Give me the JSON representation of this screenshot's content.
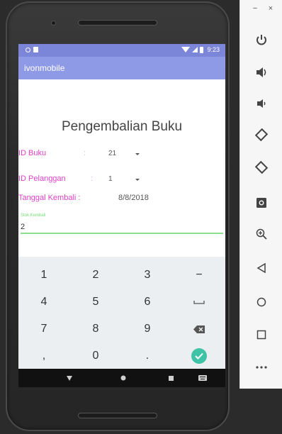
{
  "status_bar": {
    "time": "9:23"
  },
  "app": {
    "title": "ivonmobile"
  },
  "form": {
    "title": "Pengembalian Buku",
    "id_buku": {
      "label": "ID Buku",
      "colon": ":",
      "value": "21"
    },
    "id_pelanggan": {
      "label": "ID Pelanggan",
      "colon": ":",
      "value": "1"
    },
    "tanggal_kembali": {
      "label": "Tanggal Kembali :",
      "value": "8/8/2018"
    },
    "stok_kembali": {
      "hint": "Stok Kembali",
      "value": "2"
    }
  },
  "keyboard": {
    "keys": [
      {
        "label": "1",
        "name": "key-1"
      },
      {
        "label": "2",
        "name": "key-2"
      },
      {
        "label": "3",
        "name": "key-3"
      },
      {
        "label": "−",
        "name": "key-minus"
      },
      {
        "label": "4",
        "name": "key-4"
      },
      {
        "label": "5",
        "name": "key-5"
      },
      {
        "label": "6",
        "name": "key-6"
      },
      {
        "label": "",
        "name": "key-space",
        "icon": "space-icon"
      },
      {
        "label": "7",
        "name": "key-7"
      },
      {
        "label": "8",
        "name": "key-8"
      },
      {
        "label": "9",
        "name": "key-9"
      },
      {
        "label": "",
        "name": "key-backspace",
        "icon": "backspace-icon"
      },
      {
        "label": ",",
        "name": "key-comma"
      },
      {
        "label": "0",
        "name": "key-0"
      },
      {
        "label": ".",
        "name": "key-period"
      },
      {
        "label": "",
        "name": "key-done",
        "icon": "check-icon"
      }
    ],
    "accent_color": "#3fc3a6"
  },
  "navbar": {
    "icons": [
      "back-icon",
      "home-icon",
      "recents-icon",
      "keyboard-switch-icon"
    ]
  },
  "emulator_panel": {
    "window_controls": {
      "minimize": "−",
      "close": "×"
    },
    "buttons": [
      "power-icon",
      "volume-up-icon",
      "volume-down-icon",
      "rotate-left-icon",
      "rotate-right-icon",
      "camera-icon",
      "zoom-icon",
      "back-icon",
      "home-icon",
      "overview-icon",
      "more-icon"
    ]
  },
  "colors": {
    "status_bar": "#7b86d9",
    "app_bar": "#8f9ae6",
    "label_pink": "#e040c8",
    "input_green": "#8ce08c"
  }
}
